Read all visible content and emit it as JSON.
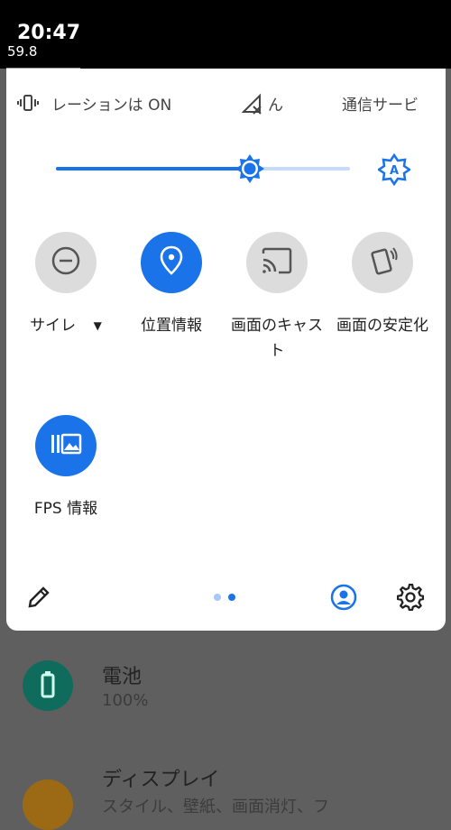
{
  "status_bar": {
    "time": "20:47",
    "fps": "59.8"
  },
  "header_tiles": {
    "vibration_label": "レーションは ON",
    "data_label": "ん",
    "carrier_label": "通信サービ"
  },
  "brightness": {
    "level": 0.66
  },
  "tiles": [
    {
      "label": "サイレ",
      "state": "off"
    },
    {
      "label": "位置情報",
      "state": "on"
    },
    {
      "label": "画面のキャスト",
      "state": "off"
    },
    {
      "label": "画面の安定化",
      "state": "off"
    },
    {
      "label": "FPS 情報",
      "state": "on"
    }
  ],
  "pager": {
    "pages": 2,
    "current": 2
  },
  "background": {
    "battery": {
      "title": "電池",
      "subtitle": "100%"
    },
    "display": {
      "title": "ディスプレイ",
      "subtitle": "スタイル、壁紙、画面消灯、フ"
    }
  },
  "colors": {
    "accent": "#1a73e8",
    "tile_off": "#dcdcdc"
  }
}
